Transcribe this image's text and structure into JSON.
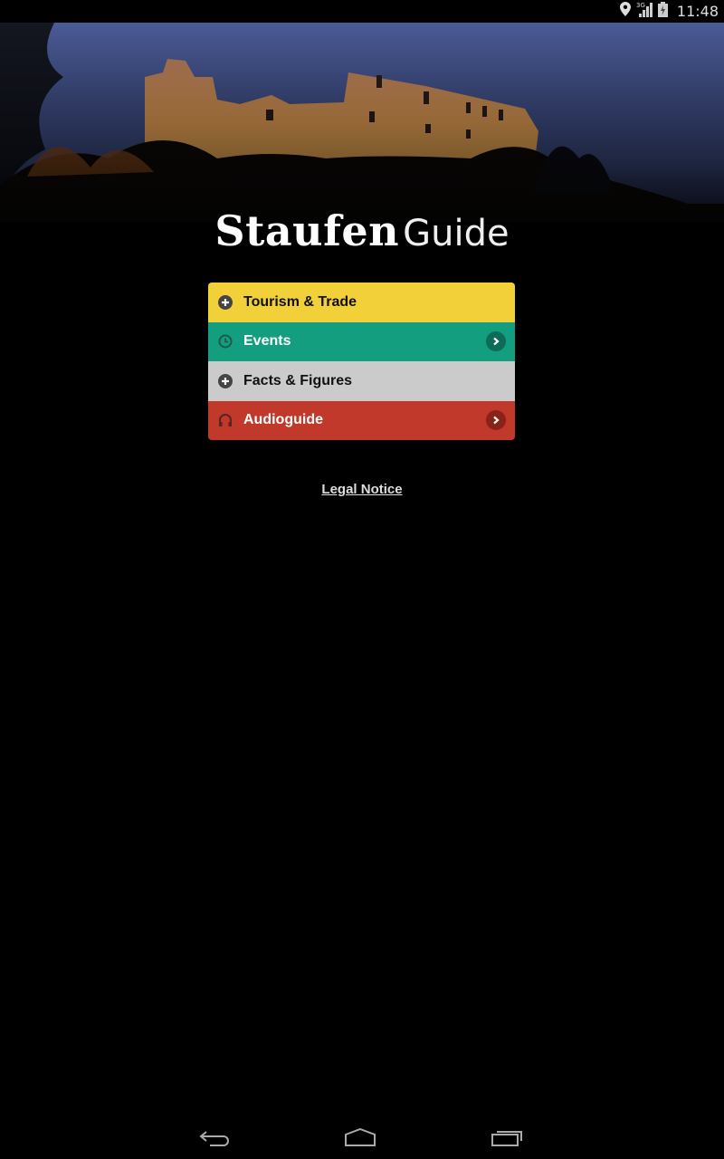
{
  "status_bar": {
    "time": "11:48",
    "network": "3G",
    "icons": [
      "location-icon",
      "signal-icon",
      "battery-icon"
    ]
  },
  "header": {
    "title_part1": "Staufen",
    "title_part2": "Guide"
  },
  "menu": {
    "items": [
      {
        "label": "Tourism & Trade",
        "icon": "plus-circle-icon",
        "has_arrow": false,
        "bg": "#f1d03a",
        "text_color": "#111111"
      },
      {
        "label": "Events",
        "icon": "clock-icon",
        "has_arrow": true,
        "bg": "#129e7f",
        "text_color": "#ffffff"
      },
      {
        "label": "Facts & Figures",
        "icon": "plus-circle-icon",
        "has_arrow": false,
        "bg": "#cbcbcb",
        "text_color": "#111111"
      },
      {
        "label": "Audioguide",
        "icon": "headphones-icon",
        "has_arrow": true,
        "bg": "#c0392b",
        "text_color": "#ffffff"
      }
    ]
  },
  "footer": {
    "legal_notice": "Legal Notice"
  },
  "nav_bar": {
    "buttons": [
      "back",
      "home",
      "recent-apps"
    ]
  }
}
